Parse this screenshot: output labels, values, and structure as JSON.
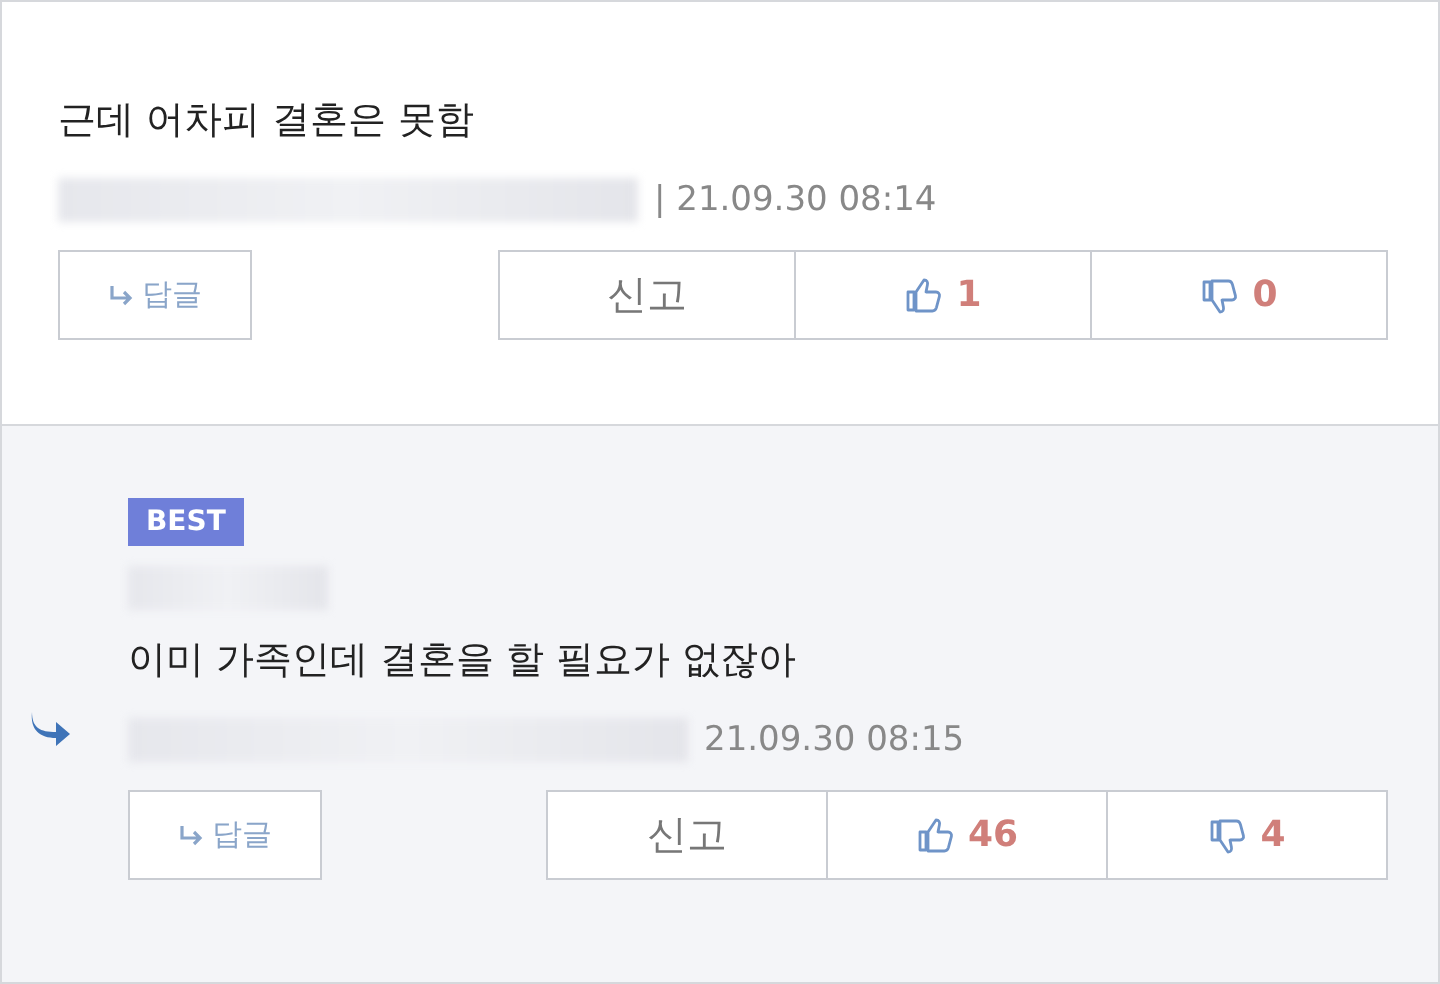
{
  "comments": [
    {
      "kind": "comment",
      "text": "근데 어차피 결혼은 못함",
      "date": "| 21.09.30 08:14",
      "reply_label": "답글",
      "report_label": "신고",
      "likes": "1",
      "dislikes": "0"
    },
    {
      "kind": "reply",
      "badge": "BEST",
      "text": "이미 가족인데 결혼을 할 필요가 없잖아",
      "date": "21.09.30 08:15",
      "reply_label": "답글",
      "report_label": "신고",
      "likes": "46",
      "dislikes": "4"
    }
  ]
}
